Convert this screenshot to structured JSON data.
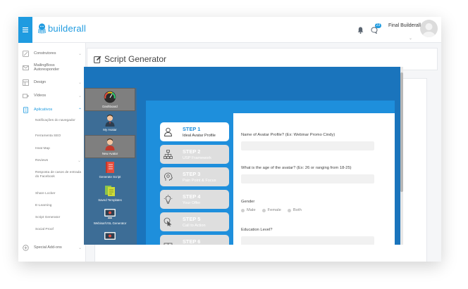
{
  "topbar": {
    "logo_text": "builderall",
    "notification_badge": "23",
    "user_name": "Final Builderall",
    "menu_icon": "hamburger-icon",
    "bell_icon": "bell-icon",
    "chat_icon": "chat-icon"
  },
  "sidebar": {
    "items": [
      {
        "label": "Construtores",
        "icon": "builder-icon"
      },
      {
        "label": "MailingBoss Autoresponder",
        "icon": "mail-icon"
      },
      {
        "label": "Design",
        "icon": "design-icon"
      },
      {
        "label": "Vídeos",
        "icon": "video-icon"
      },
      {
        "label": "Aplicativos",
        "icon": "apps-icon"
      }
    ],
    "subitems": [
      "Notificações do navegador",
      "Ferramenta SEO",
      "Heat Map",
      "Reviews",
      "Resposta de casos de entrada do Facebook",
      "Share Locker",
      "E-Learning",
      "Script Generator",
      "Social Proof"
    ],
    "bottom_item": {
      "label": "Special Add-ons",
      "icon": "addons-icon"
    }
  },
  "header": {
    "title": "Script Generator",
    "icon": "edit-icon"
  },
  "app_nav": [
    {
      "label": "Dashboard",
      "icon": "dashboard-gauge-icon",
      "selected": true
    },
    {
      "label": "My Avatar",
      "icon": "user-avatar-icon",
      "selected": false
    },
    {
      "label": "New Avatar",
      "icon": "new-avatar-icon",
      "selected": true
    },
    {
      "label": "Generate Script",
      "icon": "notebook-icon",
      "selected": false
    },
    {
      "label": "Saved Templates",
      "icon": "documents-icon",
      "selected": false
    },
    {
      "label": "Webinar/VSL Generator",
      "icon": "monitor-icon",
      "selected": false
    },
    {
      "label": "",
      "icon": "monitor-icon",
      "selected": false
    }
  ],
  "steps": [
    {
      "num": "STEP 1",
      "sub": "Ideal Avatar Profile",
      "icon": "person-icon",
      "active": true
    },
    {
      "num": "STEP 2",
      "sub": "USP Framework",
      "icon": "hierarchy-icon",
      "active": false
    },
    {
      "num": "STEP 3",
      "sub": "Pain Point & Focus",
      "icon": "head-gears-icon",
      "active": false
    },
    {
      "num": "STEP 4",
      "sub": "Your Offer",
      "icon": "lightbulb-icon",
      "active": false
    },
    {
      "num": "STEP 5",
      "sub": "Call to Action",
      "icon": "pointer-icon",
      "active": false
    },
    {
      "num": "STEP 6",
      "sub": "",
      "icon": "gift-icon",
      "active": false
    }
  ],
  "form": {
    "q1": "Name of Avatar Profile? (Ex: Webinar Promo Cindy)",
    "q2": "What is the age of the avatar? (Ex: 26 or ranging from 18-25)",
    "q3": "Gender",
    "gender_options": [
      "Male",
      "Female",
      "Both"
    ],
    "q4": "Education Level?"
  },
  "colors": {
    "accent": "#1f9be0",
    "app_bg": "#1a74bc",
    "stage_bg": "#1e8fdc",
    "nav_bg": "#3d6d96"
  }
}
